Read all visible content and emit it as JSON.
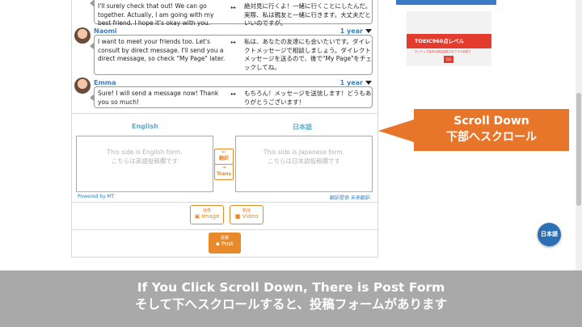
{
  "messages": [
    {
      "user": "",
      "time": "",
      "en": "I'll surely check that out! We can go together. Actually, I am going with my best friend. I hope it's okay with you.",
      "ja": "絶対見に行くよ！一緒に行くことにしたんだ。実際、私は親友と一緒に行きます。大丈夫だといいのですが。"
    },
    {
      "user": "Naomi",
      "time": "1 year",
      "en": "I want to meet your friends too. Let's consult by direct message. I'll send you a direct message, so check \"My Page\" later.",
      "ja": "私は、あなたの友達にも会いたいです。ダイレクトメッセージで相談しましょう。ダイレクトメッセージを送るので、後で\"My Page\"をチェックしてね。"
    },
    {
      "user": "Emma",
      "time": "1 year",
      "en": "Sure! I will send a message now! Thank you so much!",
      "ja": "もちろん！メッセージを送信します！どうもありがとうございます！"
    }
  ],
  "form": {
    "english_title": "English",
    "japanese_title": "日本語",
    "english_placeholder_line1": "This side is English form.",
    "english_placeholder_line2": "こちらは英語投稿欄です",
    "japanese_placeholder_line1": "This side is Japanese form.",
    "japanese_placeholder_line2": "こちらは日本語投稿欄です",
    "translate_left_arrow": "←",
    "translate_left_label": "翻訳",
    "translate_right_arrow": "→",
    "translate_right_label": "Trans",
    "powered_by": "Powered by MT",
    "translation_credit": "翻訳提供 未来翻訳",
    "image_small": "画像",
    "image_label": "Image",
    "video_small": "動画",
    "video_label": "Video",
    "post_small": "投稿",
    "post_label": "Post"
  },
  "ad": {
    "title": "TOEIC960点レベル",
    "subtitle": "ネイティブ並みの英会話能力をクラス全体で",
    "logo": "GO"
  },
  "callout": {
    "line1": "Scroll Down",
    "line2": "下部へスクロール"
  },
  "language_button": "日本語",
  "banner": {
    "line1": "If You Click Scroll Down,  There is Post Form",
    "line2": "そして下へスクロールすると、投稿フォームがあります"
  },
  "colors": {
    "accent": "#e8762a",
    "link": "#3a7fc1",
    "banner_bg": "#a9a9a9",
    "lang_button": "#2d6fb5"
  }
}
